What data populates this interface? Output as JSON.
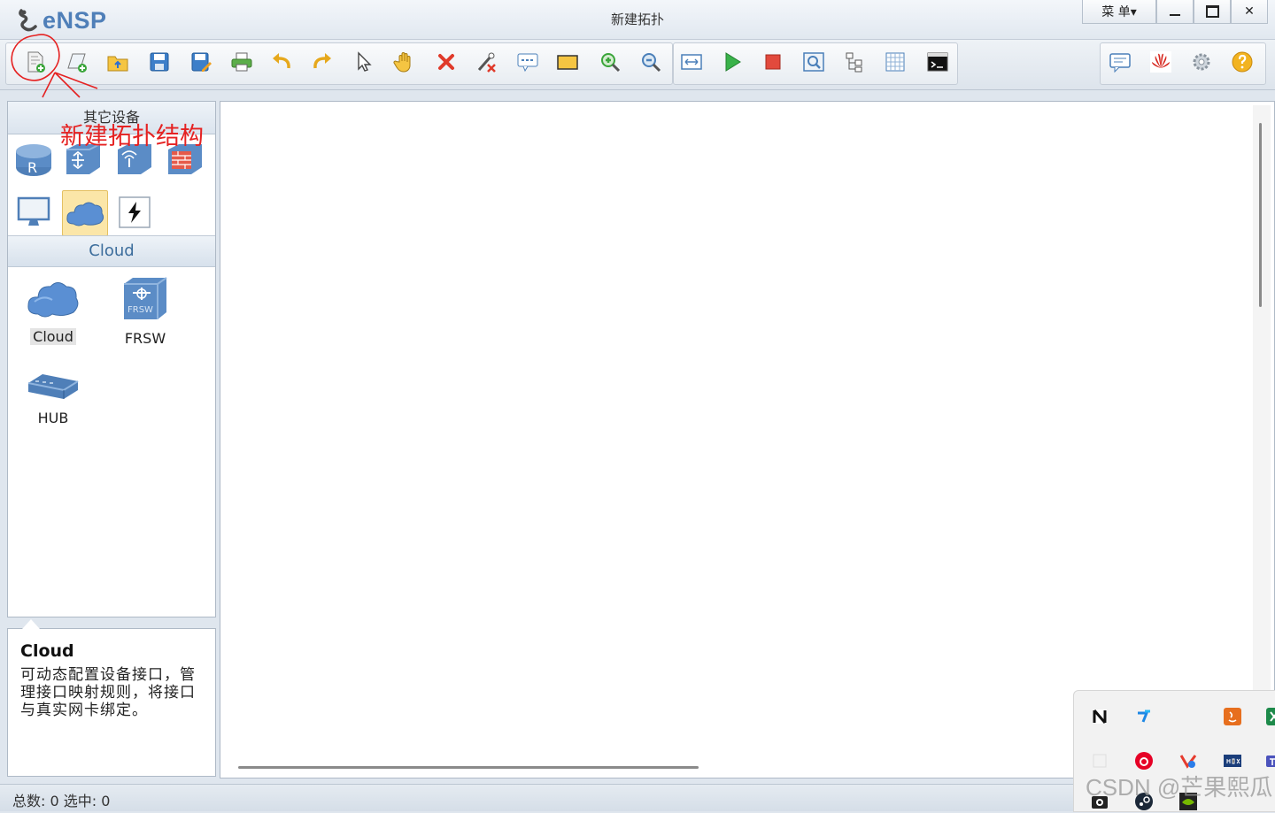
{
  "window": {
    "app_name": "eNSP",
    "title": "新建拓扑",
    "menu_label": "菜 单▾",
    "close_glyph": "✕"
  },
  "toolbar": {
    "buttons": [
      "new-topology",
      "new-lab",
      "open",
      "save",
      "save-as",
      "print",
      "undo",
      "redo",
      "select",
      "pan",
      "delete",
      "delete-link",
      "text",
      "rectangle",
      "zoom-in",
      "zoom-out",
      "fit",
      "start",
      "stop",
      "capture",
      "topology",
      "grid",
      "cli"
    ],
    "right_buttons": [
      "chat",
      "huawei",
      "settings",
      "help"
    ]
  },
  "left_panel": {
    "category_header": "其它设备",
    "category_icons": [
      "router-icon",
      "switch-icon",
      "wlan-icon",
      "firewall-icon",
      "pc-icon",
      "cloud-icon",
      "other-device-icon"
    ],
    "selected_category": "Cloud",
    "devices": [
      {
        "label": "Cloud",
        "icon": "cloud-icon"
      },
      {
        "label": "FRSW",
        "icon": "frsw-icon"
      },
      {
        "label": "HUB",
        "icon": "hub-icon"
      }
    ],
    "frsw_icon_text": "FRSW"
  },
  "description": {
    "title": "Cloud",
    "body": "可动态配置设备接口，管理接口映射规则，将接口与真实网卡绑定。"
  },
  "status": {
    "text": "总数: 0 选中: 0"
  },
  "annotation": {
    "text": "新建拓扑结构",
    "color": "#e52222"
  },
  "watermark": "CSDN @芒果熙瓜",
  "tray_icons": [
    "notion-icon",
    "app-blue-icon",
    "java-icon",
    "excel-icon",
    "blank-icon",
    "netease-icon",
    "vscode-icon",
    "hdx-icon",
    "teams-icon",
    "camera-icon",
    "steam-icon",
    "nvidia-icon"
  ]
}
